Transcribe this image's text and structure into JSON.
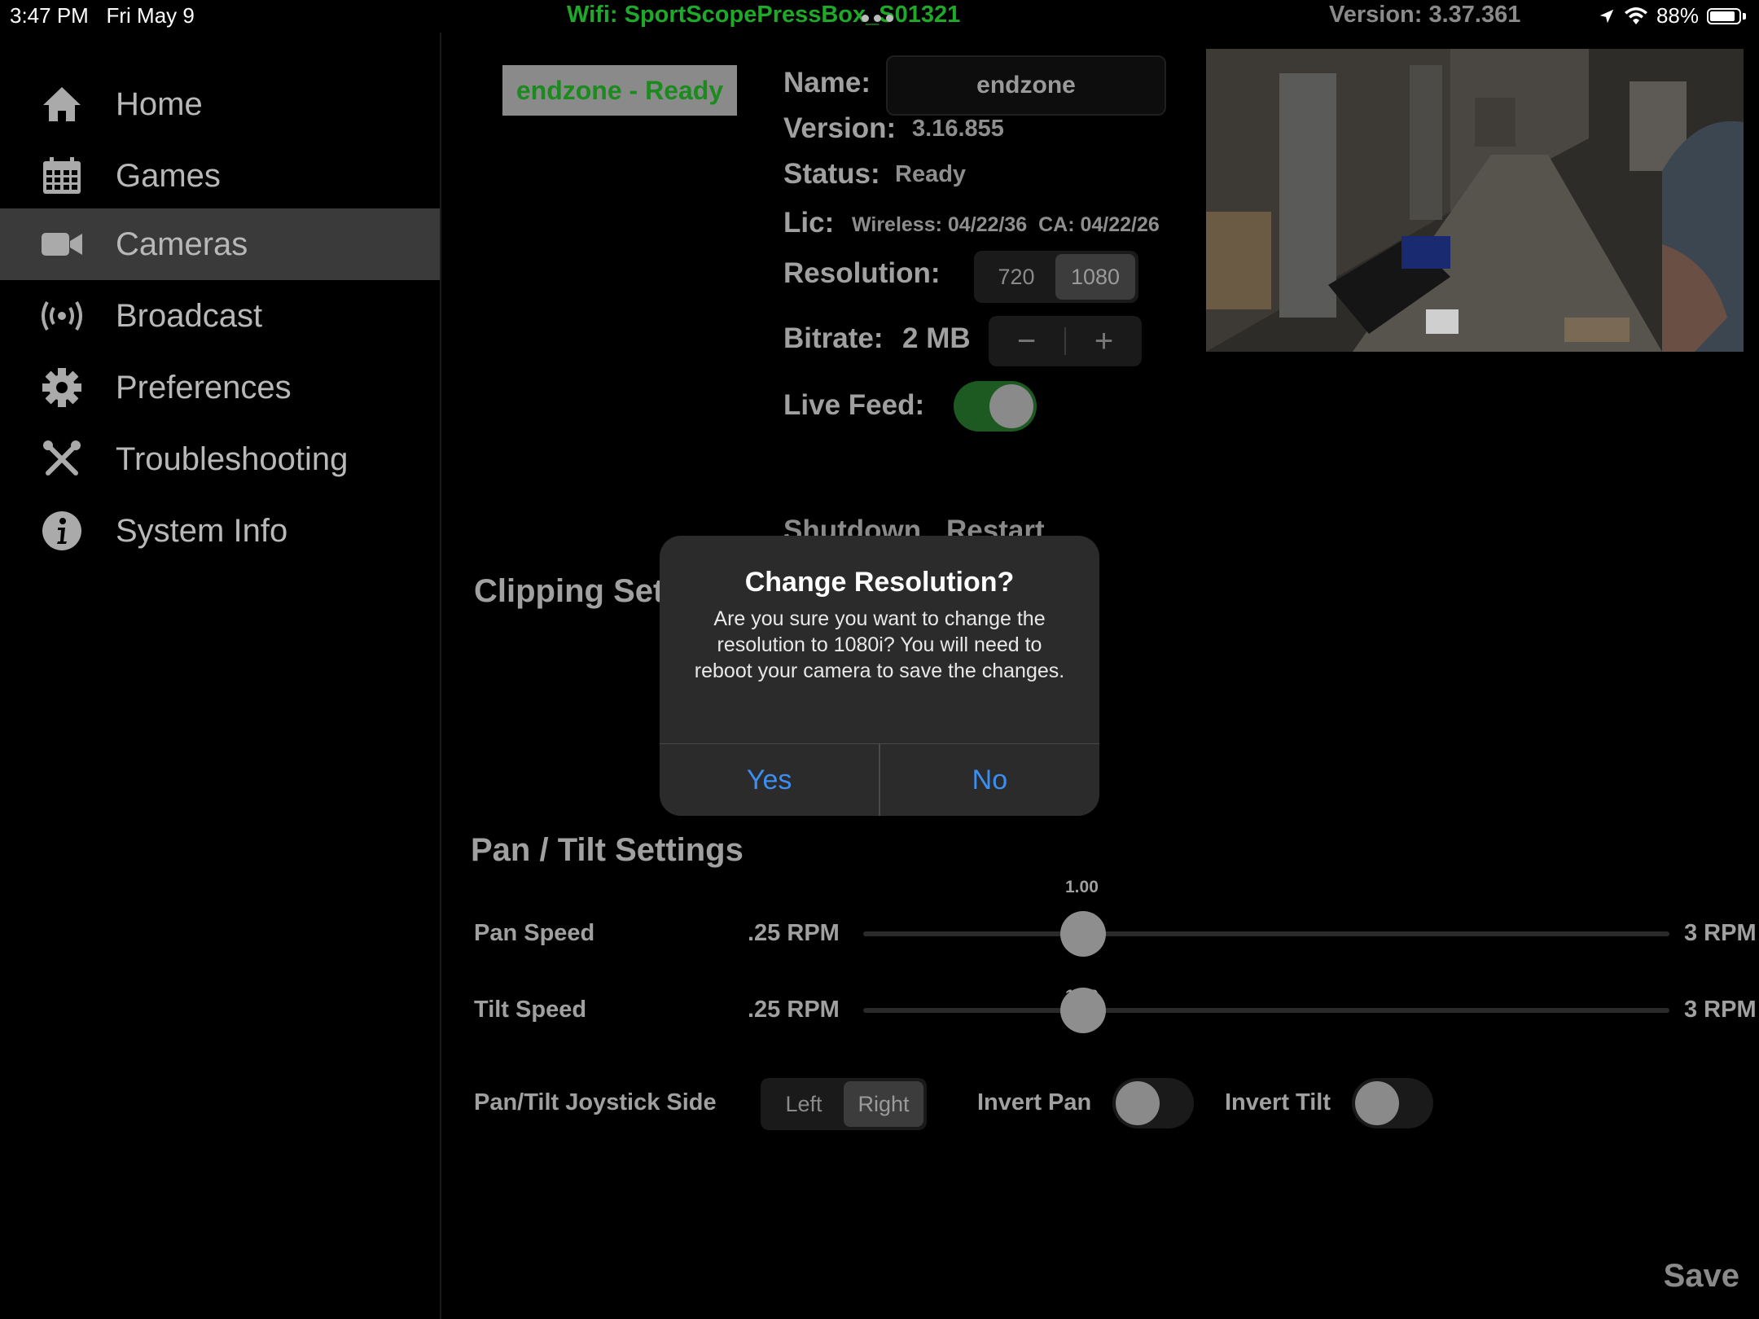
{
  "status_bar": {
    "time": "3:47 PM",
    "date": "Fri May 9",
    "wifi_label": "Wifi: SportScopePressBox_S01321",
    "app_version": "Version: 3.37.361",
    "battery_percent": "88%",
    "battery_level": 0.88
  },
  "sidebar": {
    "items": [
      {
        "label": "Home",
        "icon": "home-icon"
      },
      {
        "label": "Games",
        "icon": "calendar-icon"
      },
      {
        "label": "Cameras",
        "icon": "video-camera-icon",
        "active": true
      },
      {
        "label": "Broadcast",
        "icon": "broadcast-icon"
      },
      {
        "label": "Preferences",
        "icon": "gear-icon"
      },
      {
        "label": "Troubleshooting",
        "icon": "tools-icon"
      },
      {
        "label": "System Info",
        "icon": "info-icon"
      }
    ]
  },
  "camera": {
    "status_badge": "endzone - Ready",
    "name_label": "Name:",
    "name_value": "endzone",
    "version_label": "Version:",
    "version_value": "3.16.855",
    "status_label": "Status:",
    "status_value": "Ready",
    "lic_label": "Lic:",
    "lic_value": "Wireless: 04/22/36  CA: 04/22/26",
    "resolution_label": "Resolution:",
    "resolution_options": [
      "720",
      "1080"
    ],
    "resolution_selected": "1080",
    "bitrate_label": "Bitrate:",
    "bitrate_value": "2 MB",
    "bitrate_minus": "−",
    "bitrate_plus": "+",
    "live_feed_label": "Live Feed:",
    "live_feed_on": true,
    "shutdown_label": "Shutdown",
    "restart_label": "Restart"
  },
  "clipping": {
    "title": "Clipping Set"
  },
  "pan_tilt": {
    "title": "Pan / Tilt Settings",
    "pan_speed_label": "Pan Speed",
    "pan_min": ".25 RPM",
    "pan_max": "3 RPM",
    "pan_value": "1.00",
    "tilt_speed_label": "Tilt Speed",
    "tilt_min": ".25 RPM",
    "tilt_max": "3 RPM",
    "tilt_value": "1.00",
    "joystick_label": "Pan/Tilt Joystick Side",
    "joystick_options": [
      "Left",
      "Right"
    ],
    "joystick_selected": "Right",
    "invert_pan_label": "Invert Pan",
    "invert_pan_on": false,
    "invert_tilt_label": "Invert Tilt",
    "invert_tilt_on": false
  },
  "save_label": "Save",
  "dialog": {
    "title": "Change Resolution?",
    "message": "Are you sure you want to change the resolution to 1080i? You will need to reboot your camera to save the changes.",
    "yes_label": "Yes",
    "no_label": "No"
  },
  "colors": {
    "accent_green": "#1fa82a",
    "dialog_button_blue": "#3c8ff0",
    "toggle_on": "#1d5a22"
  }
}
